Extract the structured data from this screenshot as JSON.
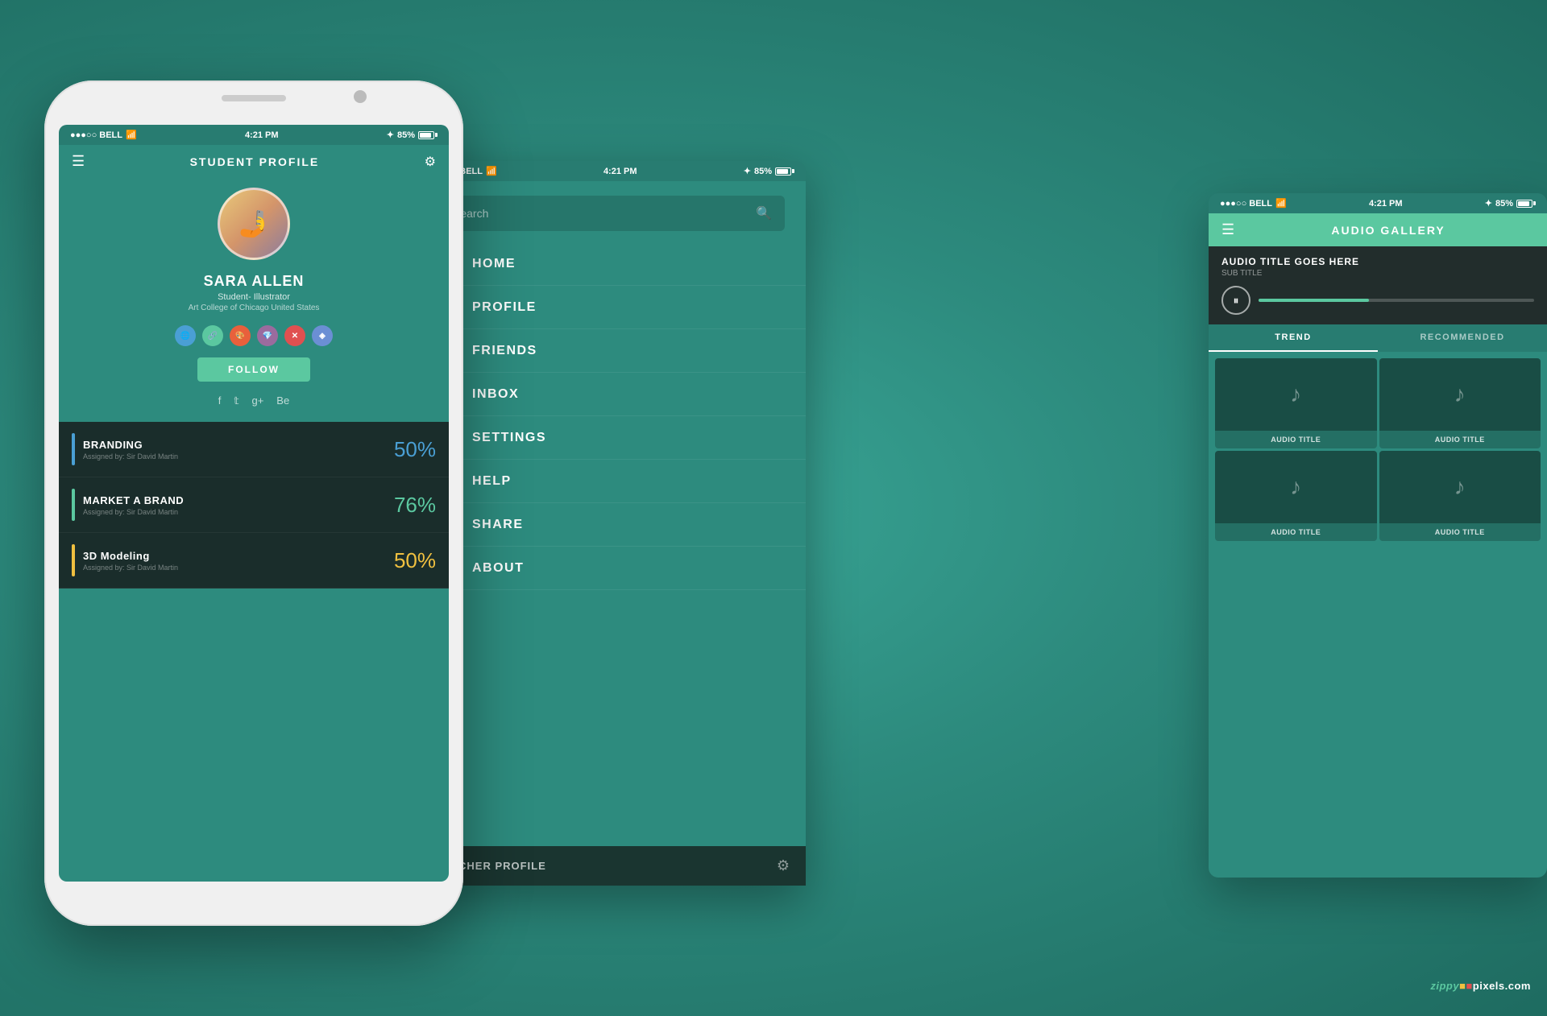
{
  "background": {
    "color": "#2d8b7e"
  },
  "phone1": {
    "status_bar": {
      "carrier": "●●●○○ BELL",
      "wifi": "WiFi",
      "time": "4:21 PM",
      "bluetooth": "BT",
      "battery": "85%"
    },
    "title": "STUDENT PROFILE",
    "user": {
      "name": "SARA ALLEN",
      "role": "Student- Illustrator",
      "school": "Art College of Chicago United States"
    },
    "follow_label": "FOLLOW",
    "social": {
      "facebook": "f",
      "twitter": "t",
      "googleplus": "g+",
      "behance": "Be"
    },
    "courses": [
      {
        "name": "BRANDING",
        "assigned": "Assigned by: Sir David Martin",
        "percent": "50%",
        "color": "#4a9fd4"
      },
      {
        "name": "MARKET A BRAND",
        "assigned": "Assigned by: Sir David Martin",
        "percent": "76%",
        "color": "#5bc8a0"
      },
      {
        "name": "3D Modeling",
        "assigned": "Assigned by: Sir David Martin",
        "percent": "50%",
        "color": "#f0c040"
      }
    ]
  },
  "phone2": {
    "status_bar": {
      "carrier": "●●●○○ BELL",
      "time": "4:21 PM",
      "battery": "85%"
    },
    "search_placeholder": "Search",
    "menu_items": [
      {
        "id": "home",
        "label": "HOME",
        "icon": "⌂"
      },
      {
        "id": "profile",
        "label": "PROFILE",
        "icon": "👤"
      },
      {
        "id": "friends",
        "label": "FRIENDS",
        "icon": "👥"
      },
      {
        "id": "inbox",
        "label": "INBOX",
        "icon": "✉"
      },
      {
        "id": "settings",
        "label": "SETTINGS",
        "icon": "⚙"
      },
      {
        "id": "help",
        "label": "HELP",
        "icon": "?"
      },
      {
        "id": "share",
        "label": "SHARE",
        "icon": "↗"
      },
      {
        "id": "about",
        "label": "ABOUT",
        "icon": "ℹ"
      }
    ],
    "bottom_label": "TEACHER PROFILE"
  },
  "phone3": {
    "status_bar": {
      "carrier": "●●●○○ BELL",
      "time": "4:21 PM",
      "battery": "85%"
    },
    "title": "AUDIO GALLERY",
    "now_playing": {
      "title": "AUDIO TITLE GOES HERE",
      "subtitle": "SUB TITLE"
    },
    "tabs": [
      {
        "id": "trend",
        "label": "TREND",
        "active": true
      },
      {
        "id": "recommended",
        "label": "RECOMMENDED",
        "active": false
      }
    ],
    "audio_items": [
      {
        "id": 1,
        "label": "AUDIO TITLE"
      },
      {
        "id": 2,
        "label": "AUDIO TITLE"
      },
      {
        "id": 3,
        "label": "AUDIO TITLE"
      },
      {
        "id": 4,
        "label": "AUDIO TITLE"
      }
    ],
    "progress_percent": 40
  },
  "watermark": {
    "brand": "zippy",
    "domain": "pixels.com"
  }
}
